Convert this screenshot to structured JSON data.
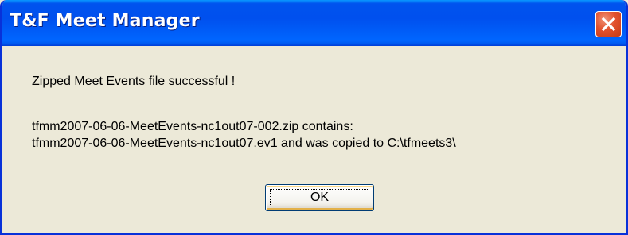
{
  "window": {
    "title": "T&F Meet Manager"
  },
  "message": {
    "line1": "Zipped Meet Events file successful !",
    "line2": "tfmm2007-06-06-MeetEvents-nc1out07-002.zip contains:",
    "line3": "tfmm2007-06-06-MeetEvents-nc1out07.ev1 and was copied to C:\\tfmeets3\\"
  },
  "buttons": {
    "ok_label": "OK"
  },
  "icons": {
    "close": "close-icon"
  },
  "colors": {
    "titlebar": "#0055ea",
    "frame": "#0831d9",
    "dialog_bg": "#ece9d8",
    "close_button": "#e2512d"
  }
}
